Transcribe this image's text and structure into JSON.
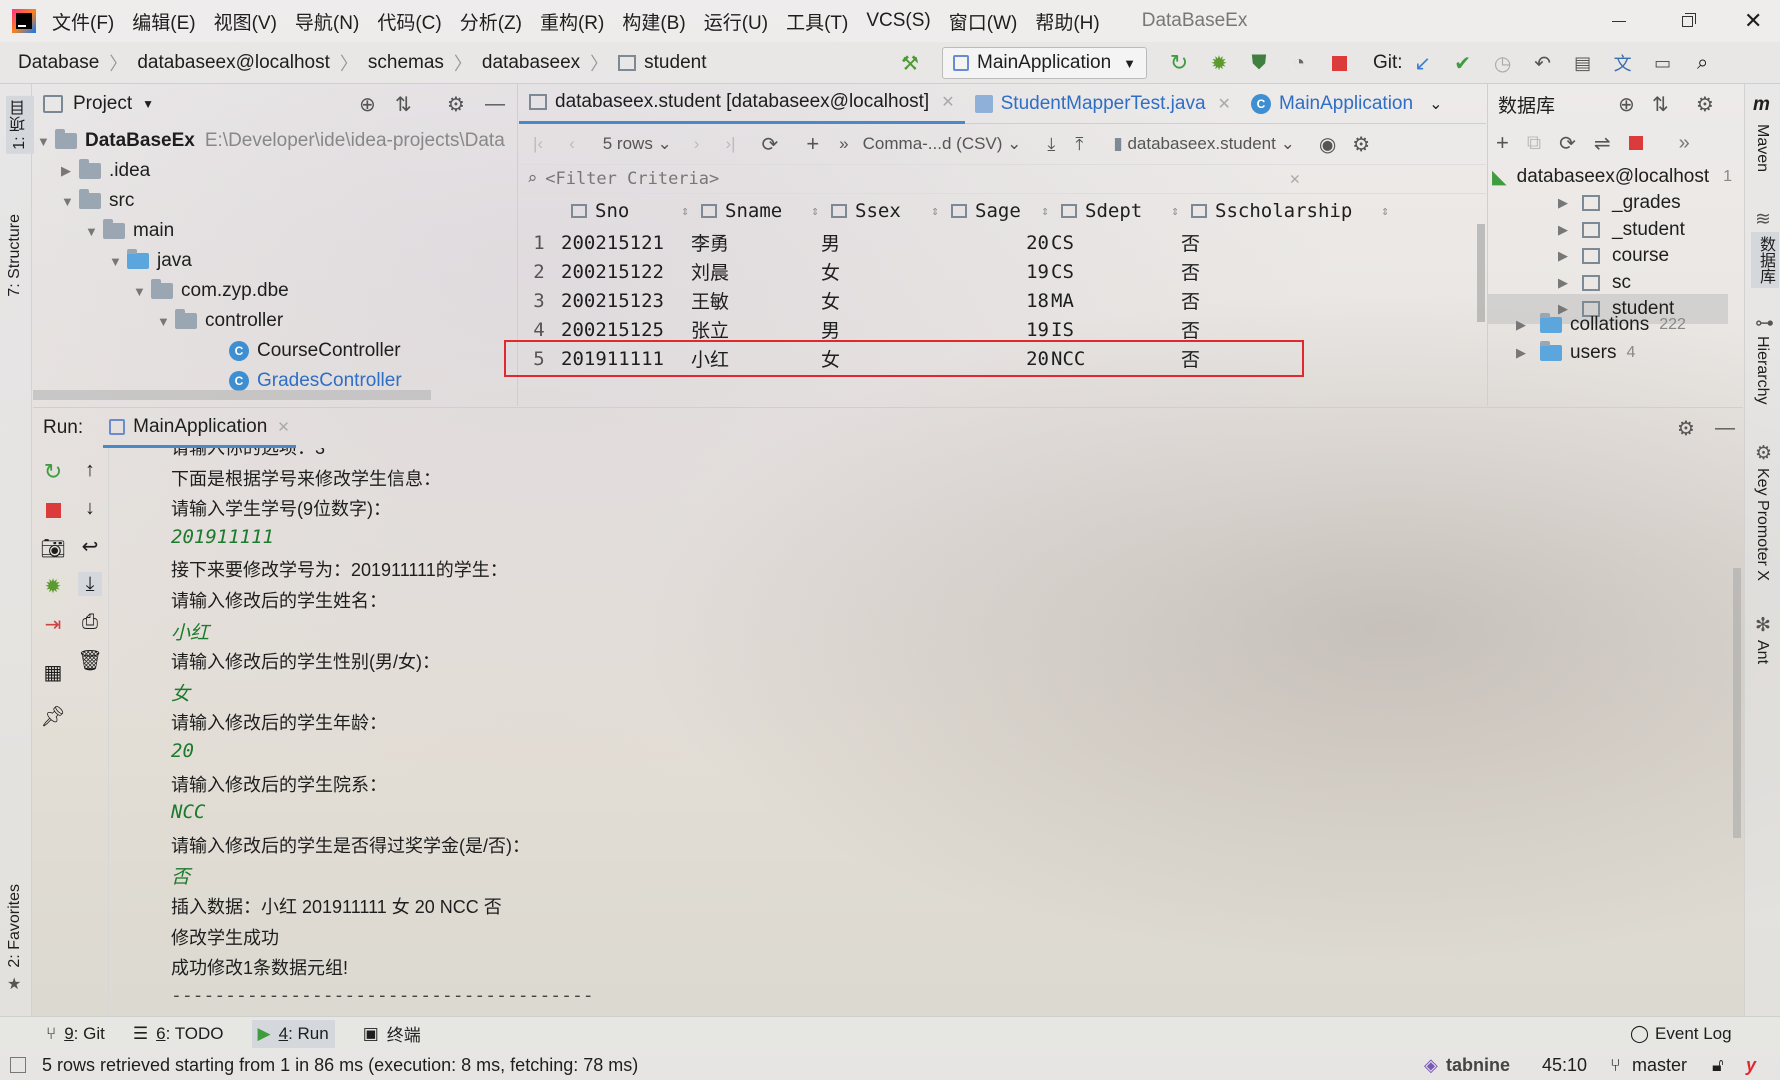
{
  "app": {
    "title": "DataBaseEx",
    "logo": "intellij-logo"
  },
  "menu": [
    "文件(F)",
    "编辑(E)",
    "视图(V)",
    "导航(N)",
    "代码(C)",
    "分析(Z)",
    "重构(R)",
    "构建(B)",
    "运行(U)",
    "工具(T)",
    "VCS(S)",
    "窗口(W)",
    "帮助(H)"
  ],
  "breadcrumb": [
    "Database",
    "databaseex@localhost",
    "schemas",
    "databaseex",
    "student"
  ],
  "toolbar": {
    "run_config": "MainApplication",
    "git_label": "Git:"
  },
  "project": {
    "header": "Project",
    "root": "DataBaseEx",
    "root_path": "E:\\Developer\\ide\\idea-projects\\Data",
    "items": [
      ".idea",
      "src",
      "main",
      "java",
      "com.zyp.dbe",
      "controller",
      "CourseController",
      "GradesController"
    ]
  },
  "editor_tabs": [
    {
      "label": "databaseex.student [databaseex@localhost]",
      "active": true
    },
    {
      "label": "StudentMapperTest.java",
      "active": false
    },
    {
      "label": "MainApplication",
      "active": false
    }
  ],
  "grid_toolbar": {
    "rows": "5 rows",
    "format": "Comma-...d (CSV)",
    "table": "databaseex.student"
  },
  "filter": {
    "placeholder": "<Filter Criteria>"
  },
  "table": {
    "columns": [
      "Sno",
      "Sname",
      "Ssex",
      "Sage",
      "Sdept",
      "Sscholarship"
    ],
    "rows": [
      [
        "1",
        "200215121",
        "李勇",
        "男",
        "20",
        "CS",
        "否"
      ],
      [
        "2",
        "200215122",
        "刘晨",
        "女",
        "19",
        "CS",
        "否"
      ],
      [
        "3",
        "200215123",
        "王敏",
        "女",
        "18",
        "MA",
        "否"
      ],
      [
        "4",
        "200215125",
        "张立",
        "男",
        "19",
        "IS",
        "否"
      ],
      [
        "5",
        "201911111",
        "小红",
        "女",
        "20",
        "NCC",
        "否"
      ]
    ],
    "highlight_color": "#e0282e"
  },
  "db_panel": {
    "header": "数据库",
    "connection": "databaseex@localhost",
    "connection_count": "1",
    "tables": [
      "_grades",
      "_student",
      "course",
      "sc",
      "student"
    ],
    "collations": "collations",
    "collations_count": "222",
    "users": "users",
    "users_count": "4"
  },
  "run": {
    "label": "Run:",
    "tab": "MainApplication",
    "lines": [
      {
        "t": "请输入你的选项：3",
        "input": false
      },
      {
        "t": "下面是根据学号来修改学生信息：",
        "input": false
      },
      {
        "t": "请输入学生学号(9位数字)：",
        "input": false
      },
      {
        "t": "201911111",
        "input": true
      },
      {
        "t": "接下来要修改学号为：201911111的学生：",
        "input": false
      },
      {
        "t": "请输入修改后的学生姓名：",
        "input": false
      },
      {
        "t": "小红",
        "input": true
      },
      {
        "t": "请输入修改后的学生性别(男/女)：",
        "input": false
      },
      {
        "t": "女",
        "input": true
      },
      {
        "t": "请输入修改后的学生年龄：",
        "input": false
      },
      {
        "t": "20",
        "input": true
      },
      {
        "t": "请输入修改后的学生院系：",
        "input": false
      },
      {
        "t": "NCC",
        "input": true
      },
      {
        "t": "请输入修改后的学生是否得过奖学金(是/否)：",
        "input": false
      },
      {
        "t": "否",
        "input": true
      },
      {
        "t": "插入数据：小红 201911111 女 20 NCC 否",
        "input": false
      },
      {
        "t": "修改学生成功",
        "input": false
      },
      {
        "t": "成功修改1条数据元组!",
        "input": false
      },
      {
        "t": "---------------------------------------",
        "input": false
      }
    ]
  },
  "left_strip": {
    "project": "1: 项目",
    "structure": "7: Structure",
    "favorites": "2: Favorites"
  },
  "right_strip": {
    "maven": "Maven",
    "database": "数据库",
    "hierarchy": "Hierarchy",
    "key_promoter": "Key Promoter X",
    "ant": "Ant"
  },
  "bottom_tabs": [
    {
      "num": "9",
      "label": ": Git"
    },
    {
      "num": "6",
      "label": ": TODO"
    },
    {
      "num": "4",
      "label": ": Run"
    },
    {
      "num": "",
      "label": "终端"
    }
  ],
  "event_log": "Event Log",
  "status": {
    "message": "5 rows retrieved starting from 1 in 86 ms (execution: 8 ms, fetching: 78 ms)",
    "tabnine": "tabnine",
    "position": "45:10",
    "branch": "master"
  }
}
